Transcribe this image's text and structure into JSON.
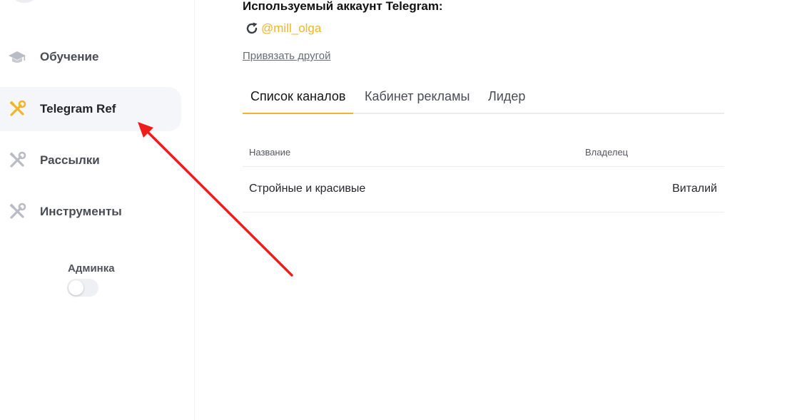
{
  "sidebar": {
    "items": [
      {
        "label": "Обучение",
        "icon": "graduation-cap-icon"
      },
      {
        "label": "Telegram Ref",
        "icon": "tools-icon"
      },
      {
        "label": "Рассылки",
        "icon": "tools-icon"
      },
      {
        "label": "Инструменты",
        "icon": "tools-icon"
      }
    ],
    "active_item": "Telegram Ref",
    "admin_label": "Админка",
    "admin_toggle_on": false
  },
  "account": {
    "title": "Используемый аккаунт Telegram:",
    "handle": "@mill_olga",
    "link_other": "Привязать другой"
  },
  "tabs": [
    {
      "label": "Список каналов"
    },
    {
      "label": "Кабинет рекламы"
    },
    {
      "label": "Лидер"
    }
  ],
  "active_tab": "Список каналов",
  "table": {
    "columns": [
      "Название",
      "Владелец"
    ],
    "rows": [
      [
        "Стройные и красивые",
        "Виталий"
      ]
    ]
  },
  "colors": {
    "accent": "#f0b52a",
    "annotation_arrow": "#ef1c1c",
    "inactive_icon": "#b9bcc4"
  }
}
